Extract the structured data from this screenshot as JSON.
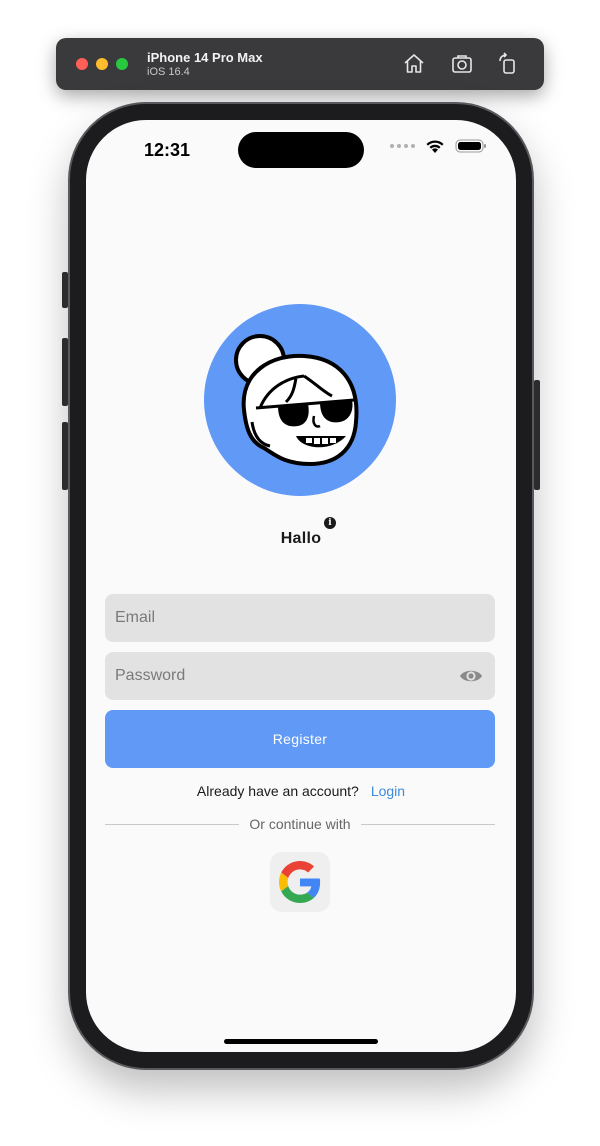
{
  "simulator": {
    "device_name": "iPhone 14 Pro Max",
    "os_version": "iOS 16.4",
    "buttons": [
      "home-icon",
      "screenshot-icon",
      "rotate-icon"
    ]
  },
  "status_bar": {
    "time": "12:31"
  },
  "greeting": {
    "title": "Hallo",
    "info_glyph": "i"
  },
  "form": {
    "email_placeholder": "Email",
    "password_placeholder": "Password",
    "register_label": "Register"
  },
  "login": {
    "prompt": "Already have an account?",
    "link_label": "Login"
  },
  "divider": {
    "text": "Or continue with"
  },
  "colors": {
    "primary": "#6199f6",
    "link": "#3d8bd9",
    "field_bg": "#e2e2e2",
    "screen_bg": "#fafafa"
  }
}
